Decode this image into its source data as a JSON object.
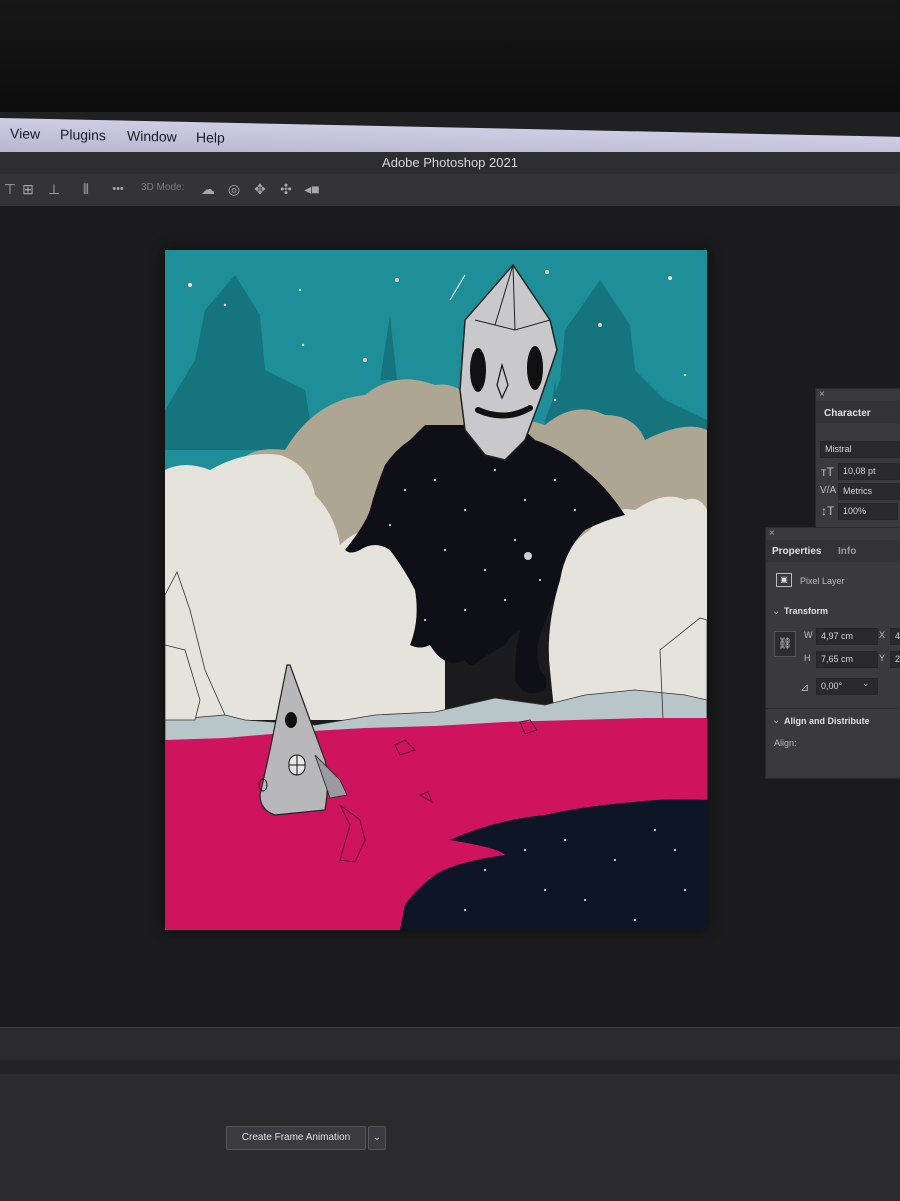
{
  "menu": {
    "items": [
      "View",
      "Plugins",
      "Window",
      "Help"
    ]
  },
  "window": {
    "title": "Adobe Photoshop 2021"
  },
  "options_bar": {
    "mode_label": "3D Mode:",
    "more_label": "•••",
    "icons": [
      "align-top-icon",
      "align-middle-icon",
      "align-bottom-icon",
      "distribute-icon",
      "orbit-3d-icon",
      "roll-3d-icon",
      "pan-3d-icon",
      "slide-3d-icon",
      "scale-3d-icon"
    ]
  },
  "character_panel": {
    "tab": "Character",
    "font_family": "Mistral",
    "font_size": "10,08 pt",
    "kerning": "Metrics",
    "vertical_scale": "100%"
  },
  "properties_panel": {
    "tabs": [
      "Properties",
      "Info"
    ],
    "layer_type": "Pixel Layer",
    "transform_heading": "Transform",
    "w_label": "W",
    "w_value": "4,97 cm",
    "h_label": "H",
    "h_value": "7,65 cm",
    "x_label": "X",
    "x_value": "4,",
    "y_label": "Y",
    "y_value": "2!",
    "angle_value": "0,00°",
    "align_heading": "Align and Distribute",
    "align_label": "Align:"
  },
  "timeline": {
    "button_label": "Create Frame Animation",
    "dropdown_glyph": "⌄"
  },
  "colors": {
    "sky": "#1e8f98",
    "magenta": "#d0135f",
    "cloud": "#e6e2dc",
    "space": "#0e1526"
  }
}
